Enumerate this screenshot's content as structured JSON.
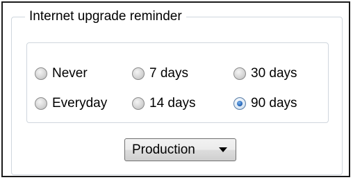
{
  "group": {
    "title": "Internet upgrade reminder"
  },
  "radios": [
    {
      "label": "Never",
      "checked": false
    },
    {
      "label": "7 days",
      "checked": false
    },
    {
      "label": "30 days",
      "checked": false
    },
    {
      "label": "Everyday",
      "checked": false
    },
    {
      "label": "14 days",
      "checked": false
    },
    {
      "label": "90 days",
      "checked": true
    }
  ],
  "dropdown": {
    "selected": "Production"
  },
  "colors": {
    "group_border": "#cfd6dd",
    "radio_checked_dot": "#2c6fc2"
  }
}
